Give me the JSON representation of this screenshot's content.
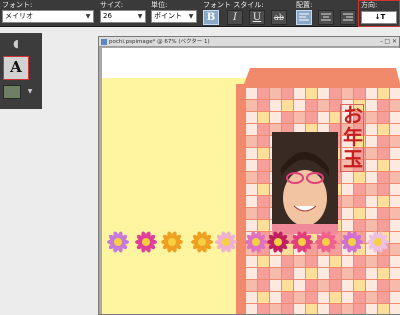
{
  "options_bar": {
    "font_label": "フォント:",
    "font_value": "メイリオ",
    "size_label": "サイズ:",
    "size_value": "26",
    "unit_label": "単位:",
    "unit_value": "ポイント",
    "style_label": "フォント スタイル:",
    "style_bold": "B",
    "style_italic": "I",
    "style_underline": "U",
    "style_strike": "ab",
    "align_label": "配置:",
    "direction_label": "方向:",
    "direction_glyph": "↓T"
  },
  "toolbox": {
    "text_tool_glyph": "A"
  },
  "document": {
    "title": "pochi.pspimage* @ 67% (ベクター 1)"
  },
  "envelope": {
    "label_text": "お年玉",
    "colors": {
      "background": "#fff89a",
      "flap": "#f08a6a",
      "checker_pink": "#f6a0a0",
      "checker_white": "#fff3ee",
      "checker_yellow": "#ffe8a0",
      "label_red": "#c41e1e"
    }
  },
  "colors": {
    "toolbar_bg": "#3a3a3a",
    "highlight_red": "#d03434",
    "active_button": "#8aa8c8"
  }
}
